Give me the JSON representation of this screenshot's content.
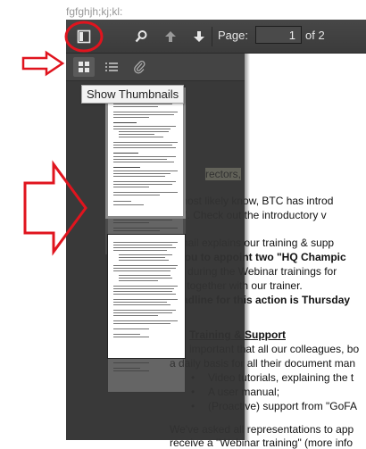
{
  "page_url": "fgfghjh;kj;kl:",
  "toolbar": {
    "page_label": "Page:",
    "page_value": "1",
    "page_of": "of 2",
    "icons": [
      "sidebar-toggle-icon",
      "search-icon",
      "previous-page-icon",
      "next-page-icon"
    ]
  },
  "sidebar": {
    "tabs": [
      "thumbnails-icon",
      "outline-icon",
      "attachments-icon"
    ],
    "tooltip": "Show Thumbnails"
  },
  "document": {
    "lines": [
      "rectors,",
      "u most likely know, BTC has introd",
      "ST\". Check out the introductory v",
      "e-mail explains our training & supp",
      "s you to appoint two \"HQ Champic",
      "ent during the Webinar trainings for",
      "ing together with our trainer.",
      "deadline for this action is Thursday",
      "Training & Support",
      "It is important that all our colleagues, bo",
      "a daily basis for all their document man",
      "Video tutorials, explaining the t",
      "A user manual;",
      "(Proactive) support from \"GoFA",
      "We've asked all representations to app",
      "receive a \"Webinar training\" (more info"
    ]
  },
  "annotations": {
    "circle_color": "#e0141e",
    "arrow_color": "#e0141e"
  }
}
